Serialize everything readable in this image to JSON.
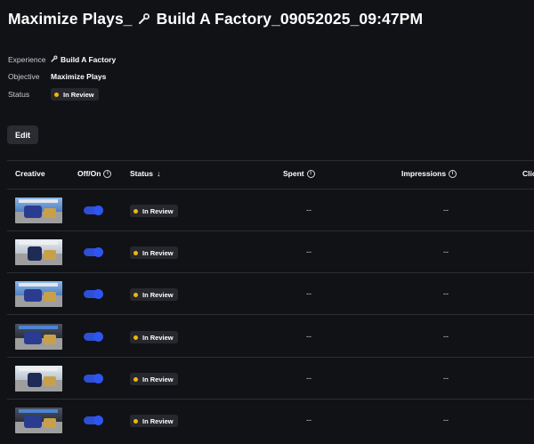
{
  "page": {
    "title_prefix": "Maximize Plays_",
    "title_suffix": "Build A Factory_09052025_09:47PM"
  },
  "meta": {
    "experience_label": "Experience",
    "experience_value": "Build A Factory",
    "objective_label": "Objective",
    "objective_value": "Maximize Plays",
    "status_label": "Status",
    "status_value": "In Review"
  },
  "edit_button": "Edit",
  "table": {
    "columns": [
      "Creative",
      "Off/On",
      "Status",
      "Spent",
      "Impressions",
      "Clic"
    ],
    "rows": [
      {
        "status": "In Review",
        "spent": "--",
        "impressions": "--",
        "enabled": true
      },
      {
        "status": "In Review",
        "spent": "--",
        "impressions": "--",
        "enabled": true
      },
      {
        "status": "In Review",
        "spent": "--",
        "impressions": "--",
        "enabled": true
      },
      {
        "status": "In Review",
        "spent": "--",
        "impressions": "--",
        "enabled": true
      },
      {
        "status": "In Review",
        "spent": "--",
        "impressions": "--",
        "enabled": true
      },
      {
        "status": "In Review",
        "spent": "--",
        "impressions": "--",
        "enabled": true
      }
    ]
  },
  "colors": {
    "background": "#111216",
    "toggle_on": "#2f55f0",
    "status_dot": "#f2b705"
  },
  "icons": {
    "title_icon": "wrench-icon",
    "info_icon": "info-icon",
    "sort_icon": "arrow-down-icon"
  }
}
